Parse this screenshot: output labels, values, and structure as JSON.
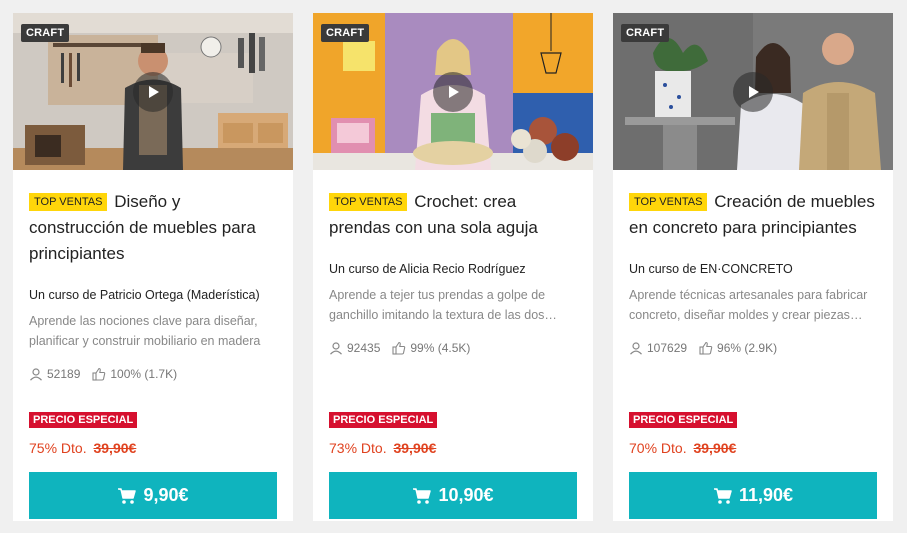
{
  "cards": [
    {
      "category": "CRAFT",
      "badge": "TOP VENTAS",
      "title": "Diseño y construcción de muebles para principiantes",
      "author": "Un curso de Patricio Ortega (Maderística)",
      "description": "Aprende las nociones clave para diseñar, planificar y construir mobiliario en madera",
      "students": "52189",
      "rating": "100% (1.7K)",
      "special_label": "PRECIO ESPECIAL",
      "discount": "75% Dto.",
      "old_price": "39,90€",
      "price": "9,90€"
    },
    {
      "category": "CRAFT",
      "badge": "TOP VENTAS",
      "title": "Crochet: crea prendas con una sola aguja",
      "author": "Un curso de Alicia Recio Rodríguez",
      "description": "Aprende a tejer tus prendas a golpe de ganchillo imitando la textura de las dos agujas",
      "students": "92435",
      "rating": "99% (4.5K)",
      "special_label": "PRECIO ESPECIAL",
      "discount": "73% Dto.",
      "old_price": "39,90€",
      "price": "10,90€"
    },
    {
      "category": "CRAFT",
      "badge": "TOP VENTAS",
      "title": "Creación de muebles en concreto para principiantes",
      "author": "Un curso de EN·CONCRETO",
      "description": "Aprende técnicas artesanales para fabricar concreto, diseñar moldes y crear piezas decorativas",
      "students": "107629",
      "rating": "96% (2.9K)",
      "special_label": "PRECIO ESPECIAL",
      "discount": "70% Dto.",
      "old_price": "39,90€",
      "price": "11,90€"
    }
  ],
  "icons": {
    "play": "play-icon",
    "students": "user-icon",
    "rating": "thumbs-up-icon",
    "cart": "cart-icon"
  },
  "colors": {
    "badge_yellow": "#ffd60a",
    "special_red": "#d6102f",
    "discount_orange": "#e0421f",
    "button_teal": "#0fb4be"
  }
}
